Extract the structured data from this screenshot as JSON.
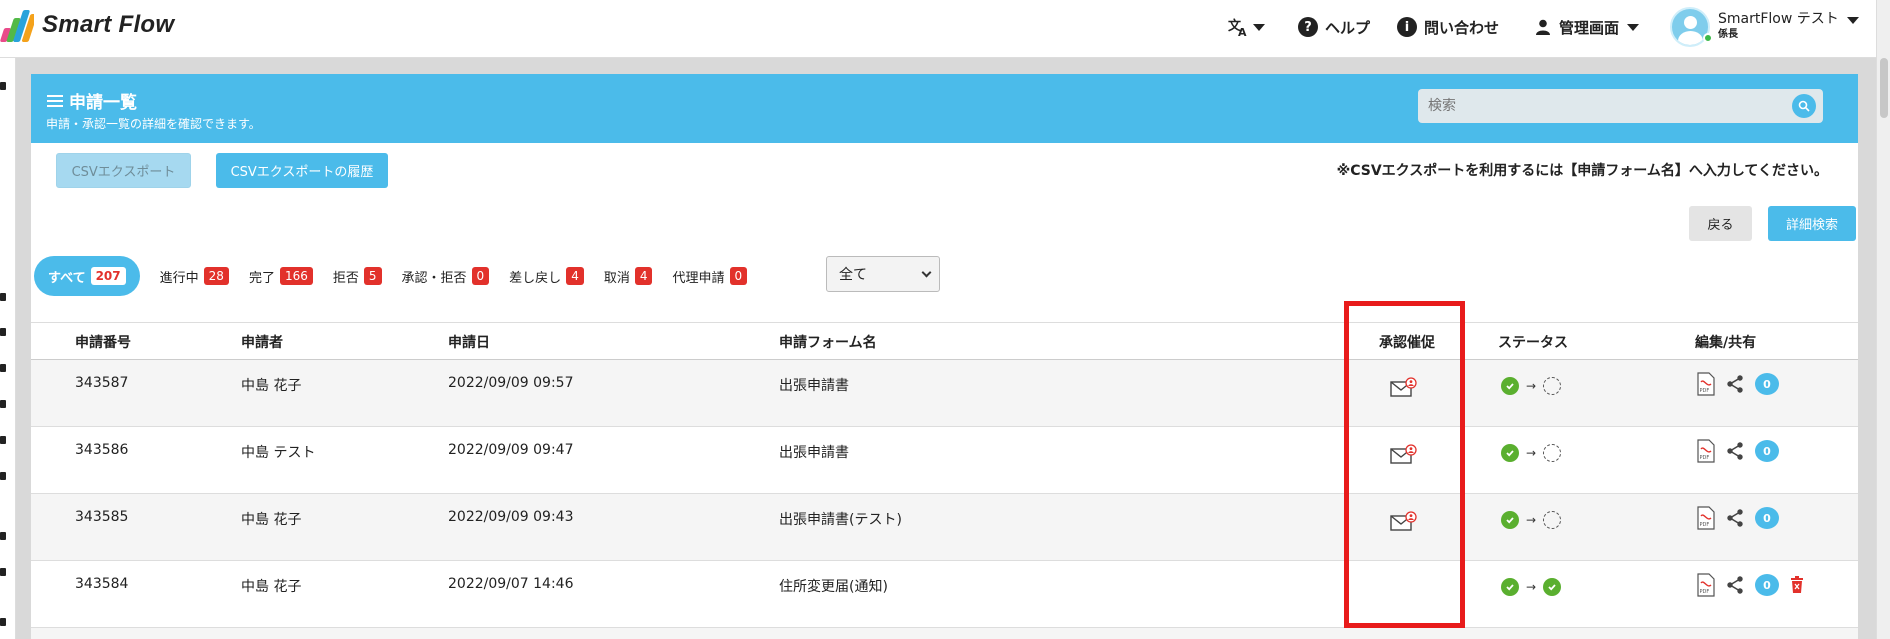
{
  "app": {
    "logo_text": "Smart Flow"
  },
  "header": {
    "help_label": "ヘルプ",
    "contact_label": "問い合わせ",
    "admin_label": "管理画面",
    "user_name": "SmartFlow テスト",
    "user_role": "係長"
  },
  "page": {
    "title": "申請一覧",
    "subtitle": "申請・承認一覧の詳細を確認できます。",
    "search_placeholder": "検索"
  },
  "toolbar": {
    "csv_export_label": "CSVエクスポート",
    "csv_history_label": "CSVエクスポートの履歴",
    "notice": "※CSVエクスポートを利用するには【申請フォーム名】へ入力してください。",
    "back_label": "戻る",
    "advanced_search_label": "詳細検索"
  },
  "tabs": [
    {
      "label": "すべて",
      "count": "207"
    },
    {
      "label": "進行中",
      "count": "28"
    },
    {
      "label": "完了",
      "count": "166"
    },
    {
      "label": "拒否",
      "count": "5"
    },
    {
      "label": "承認・拒否",
      "count": "0"
    },
    {
      "label": "差し戻し",
      "count": "4"
    },
    {
      "label": "取消",
      "count": "4"
    },
    {
      "label": "代理申請",
      "count": "0"
    }
  ],
  "filter": {
    "selected": "全て"
  },
  "table": {
    "columns": [
      "申請番号",
      "申請者",
      "申請日",
      "申請フォーム名",
      "承認催促",
      "ステータス",
      "編集/共有"
    ],
    "rows": [
      {
        "id": "343587",
        "applicant": "中島 花子",
        "date": "2022/09/09 09:57",
        "form": "出張申請書",
        "comments": "0"
      },
      {
        "id": "343586",
        "applicant": "中島 テスト",
        "date": "2022/09/09 09:47",
        "form": "出張申請書",
        "comments": "0"
      },
      {
        "id": "343585",
        "applicant": "中島 花子",
        "date": "2022/09/09 09:43",
        "form": "出張申請書(テスト)",
        "comments": "0"
      },
      {
        "id": "343584",
        "applicant": "中島 花子",
        "date": "2022/09/07 14:46",
        "form": "住所変更届(通知)",
        "comments": "0"
      }
    ]
  },
  "colors": {
    "accent": "#4bbbea",
    "badge_red": "#e2312b",
    "highlight": "#e81b1b",
    "status_green": "#5aaf2f"
  },
  "icons": [
    "translate-icon",
    "help-icon",
    "info-icon",
    "user-icon",
    "search-icon",
    "mail-alert-icon",
    "pdf-icon",
    "share-icon",
    "chat-icon",
    "trash-icon"
  ]
}
